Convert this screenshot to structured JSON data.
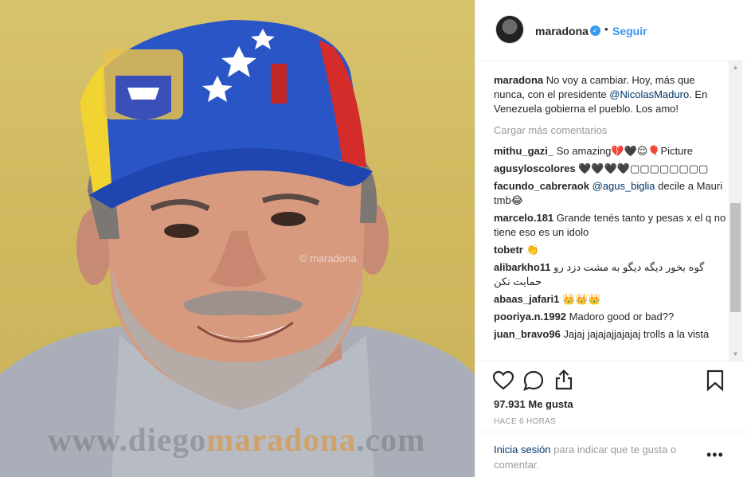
{
  "photo": {
    "watermark_handle": "© maradona",
    "watermark_site_part1": "www.diego",
    "watermark_site_part2": "maradona",
    "watermark_site_part3": ".com"
  },
  "header": {
    "username": "maradona",
    "verified_icon": "verified-badge-icon",
    "separator": "•",
    "follow_label": "Seguir"
  },
  "caption": {
    "user": "maradona",
    "text_before": "No voy a cambiar. Hoy, más que nunca, con el presidente ",
    "mention": "@NicolasMaduro",
    "text_after": ". En Venezuela gobierna el pueblo. Los amo!"
  },
  "load_more": "Cargar más comentarios",
  "comments": [
    {
      "user": "mithu_gazi_",
      "text": "So amazing💔🖤😌🎈Picture"
    },
    {
      "user": "agusyloscolores",
      "text": "🖤🖤🖤🖤▢▢▢▢▢▢▢▢"
    },
    {
      "user": "facundo_cabreraok",
      "mention": "@agus_biglia",
      "text": " decile a Mauri tmb😂"
    },
    {
      "user": "marcelo.181",
      "text": "Grande tenés tanto y pesas x el q no tiene eso es un idolo"
    },
    {
      "user": "tobetr",
      "text": "👏"
    },
    {
      "user": "alibarkho11",
      "text": "گوه بخور دیگه دیگو به مشت دزد رو حمایت نکن"
    },
    {
      "user": "abaas_jafari1",
      "text": "👑👑👑"
    },
    {
      "user": "pooriya.n.1992",
      "text": "Madoro good or bad??"
    },
    {
      "user": "juan_bravo96",
      "text": "Jajaj jajajajjajajaj trolls a la vista"
    }
  ],
  "actions": {
    "like_icon": "heart-icon",
    "comment_icon": "comment-icon",
    "share_icon": "share-icon",
    "save_icon": "bookmark-icon"
  },
  "likes": "97.931 Me gusta",
  "time": "HACE 6 HORAS",
  "login": {
    "link": "Inicia sesión",
    "text": " para indicar que te gusta o comentar."
  },
  "more_options": "•••"
}
